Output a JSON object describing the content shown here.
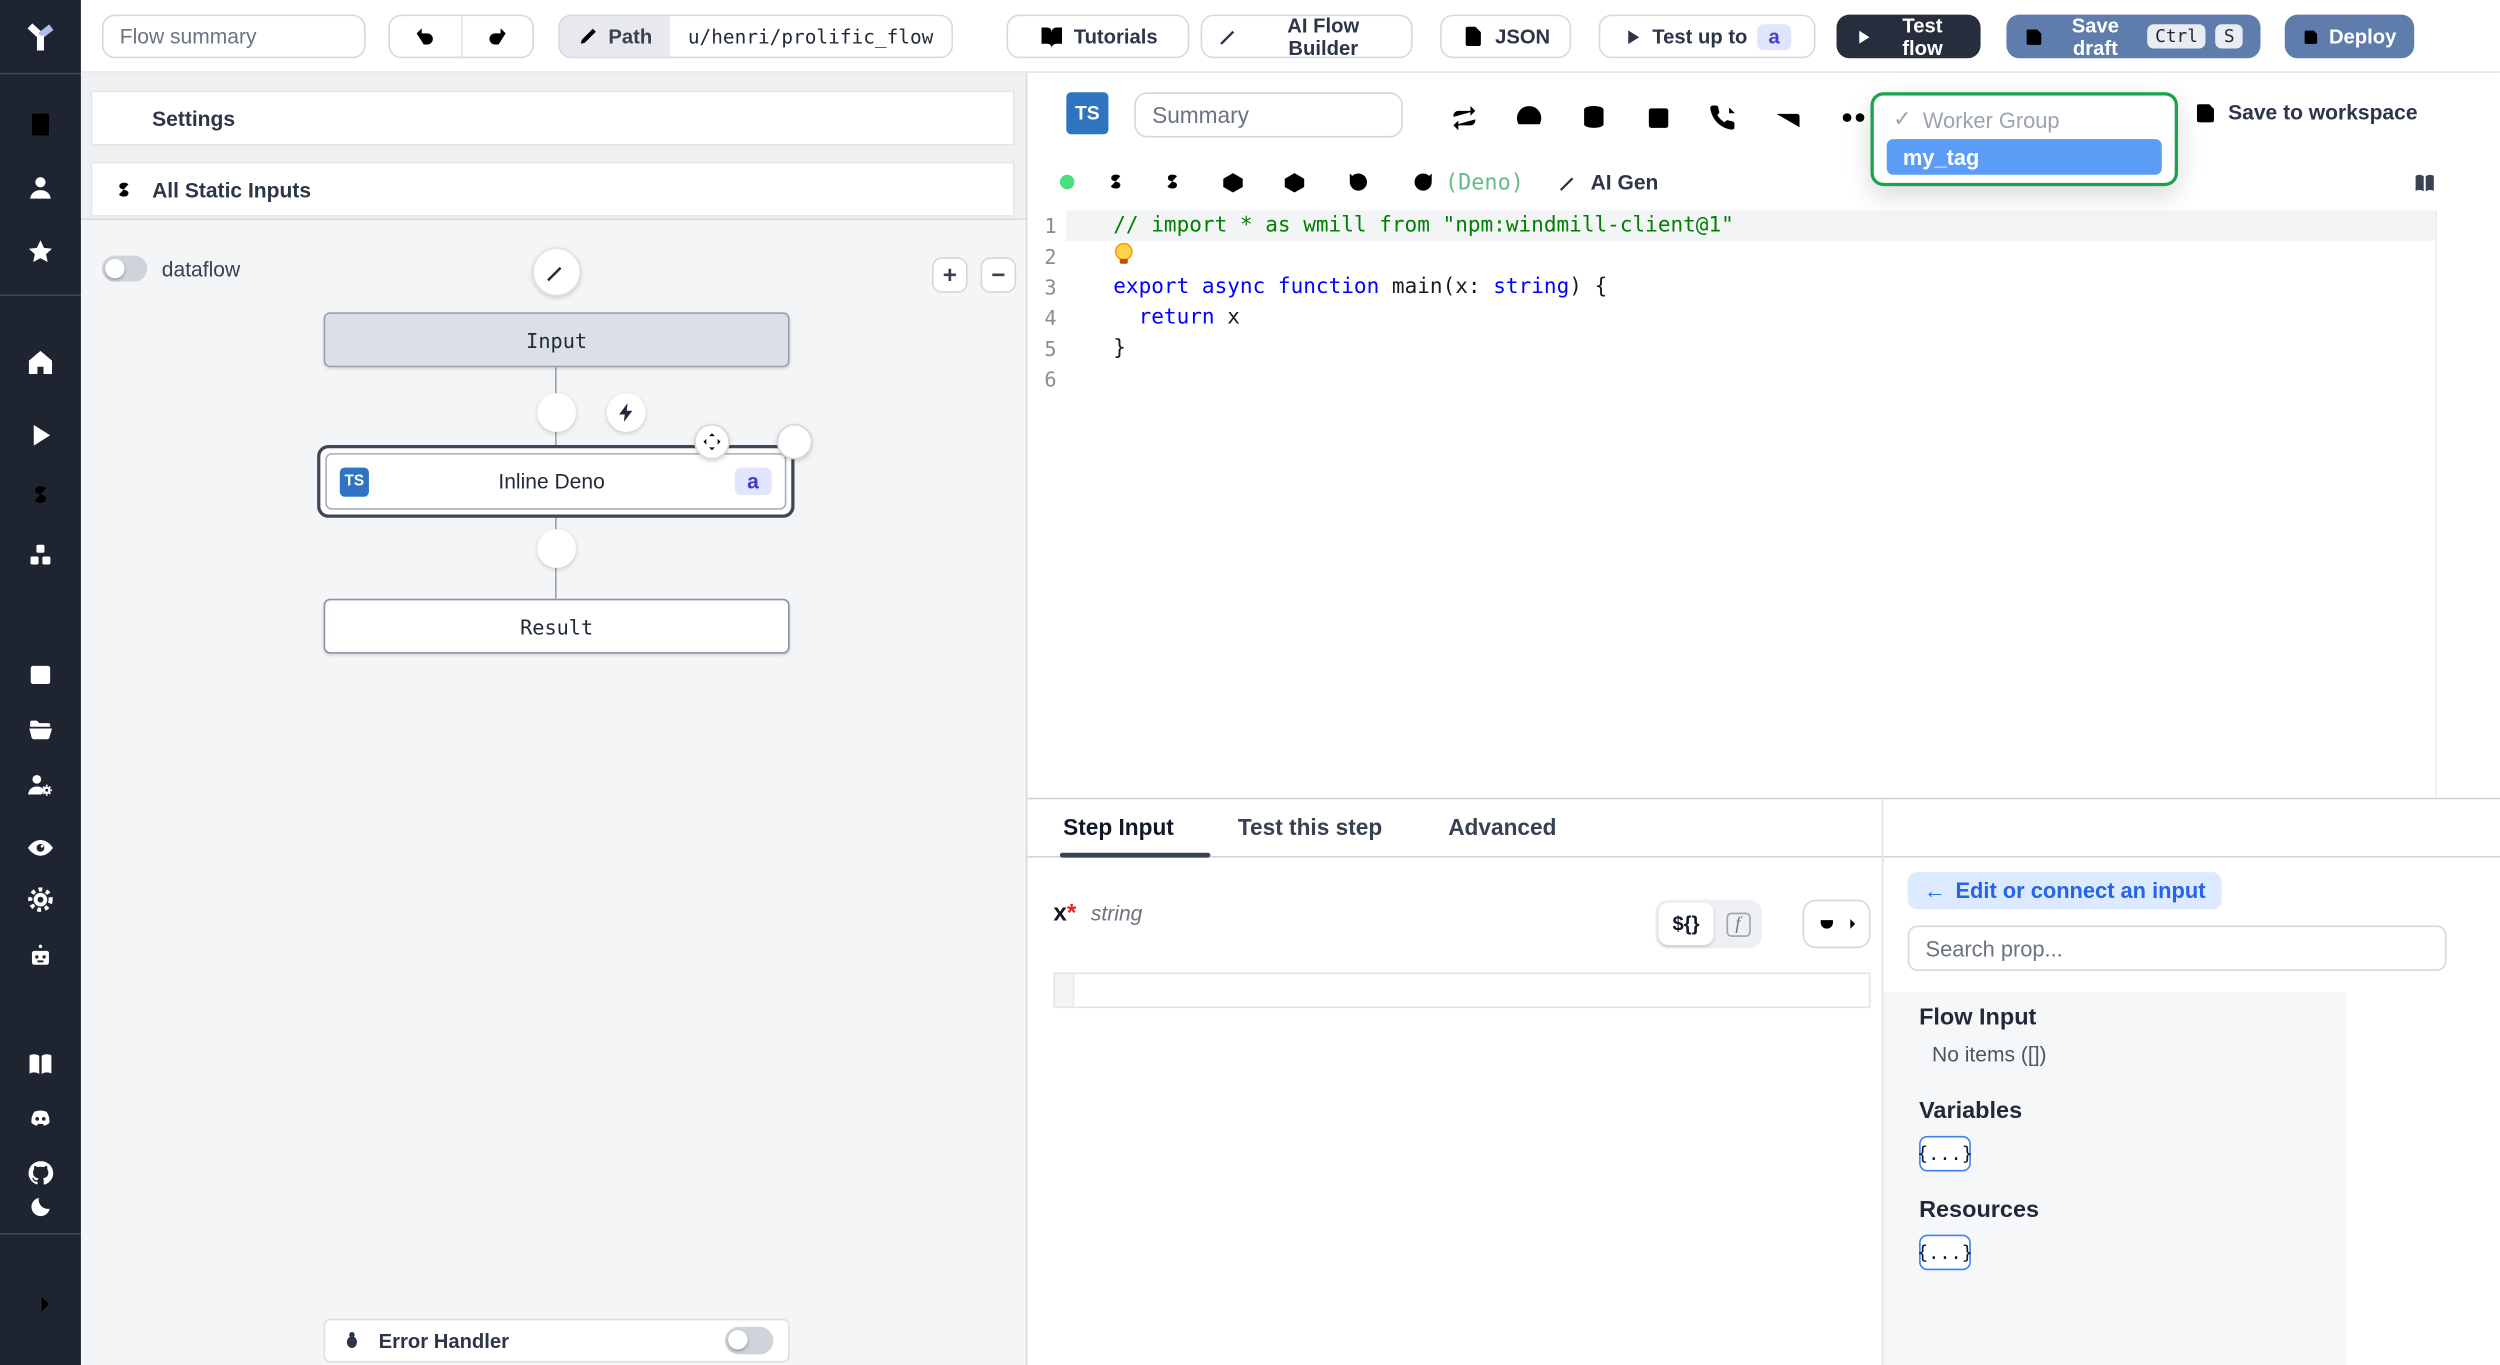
{
  "topbar": {
    "flow_summary_placeholder": "Flow summary",
    "path_button_label": "Path",
    "path_value": "u/henri/prolific_flow",
    "tutorials_label": "Tutorials",
    "ai_flow_builder_label": "AI Flow Builder",
    "json_label": "JSON",
    "test_up_to_label": "Test up to",
    "test_up_to_badge": "a",
    "test_flow_label": "Test flow",
    "save_draft_label": "Save draft",
    "shortcut_keys": [
      "Ctrl",
      "S"
    ],
    "deploy_label": "Deploy"
  },
  "sidebar": {
    "icons": [
      "windmill-logo",
      "building",
      "user",
      "star",
      "home",
      "play",
      "dollar",
      "boxes",
      "calendar",
      "folder-open",
      "users-cog",
      "eye",
      "gear",
      "bot",
      "book-open",
      "discord",
      "github",
      "moon",
      "arrow-right"
    ]
  },
  "flow_panel": {
    "settings_label": "Settings",
    "static_inputs_label": "All Static Inputs",
    "dataflow_label": "dataflow",
    "zoom_in": "+",
    "zoom_out": "−",
    "nodes": {
      "input_label": "Input",
      "step": {
        "language": "TS",
        "label": "Inline Deno",
        "badge": "a"
      },
      "result_label": "Result"
    },
    "error_handler_label": "Error Handler"
  },
  "editor": {
    "language_badge": "TS",
    "summary_placeholder": "Summary",
    "runtime_label": "(Deno)",
    "ai_gen_label": "AI Gen",
    "save_to_workspace_label": "Save to workspace",
    "worker_group_dropdown": {
      "check": "✓",
      "group_label": "Worker Group",
      "options": [
        {
          "label": "my_tag",
          "selected": true
        }
      ]
    },
    "toolbar_icons_row1": [
      "repeat",
      "gauge",
      "database",
      "square",
      "phone-incoming",
      "bed",
      "voicemail"
    ],
    "toolbar_icons_row2": [
      "status-dot",
      "dollar",
      "dollar",
      "package",
      "package",
      "rotate-ccw",
      "refresh-cw"
    ],
    "code": {
      "lines": [
        [
          {
            "t": "// import * as wmill from \"npm:windmill-client@1\"",
            "c": "comment"
          }
        ],
        [
          {
            "t": "lightbulb",
            "c": "bulb"
          }
        ],
        [
          {
            "t": "export",
            "c": "kw"
          },
          {
            "t": " ",
            "c": "pl"
          },
          {
            "t": "async",
            "c": "kw"
          },
          {
            "t": " ",
            "c": "pl"
          },
          {
            "t": "function",
            "c": "kw"
          },
          {
            "t": " main(x: ",
            "c": "pl"
          },
          {
            "t": "string",
            "c": "kw"
          },
          {
            "t": ") {",
            "c": "pl"
          }
        ],
        [
          {
            "t": "  ",
            "c": "pl"
          },
          {
            "t": "return",
            "c": "kw"
          },
          {
            "t": " x",
            "c": "pl"
          }
        ],
        [
          {
            "t": "}",
            "c": "pl"
          }
        ],
        []
      ]
    }
  },
  "step_panel": {
    "tabs": [
      {
        "label": "Step Input",
        "active": true
      },
      {
        "label": "Test this step",
        "active": false
      },
      {
        "label": "Advanced",
        "active": false
      }
    ],
    "field": {
      "name": "x",
      "required_marker": "*",
      "type": "string",
      "value": ""
    },
    "expr_toggle": {
      "template_label": "${}",
      "code_label": "f"
    },
    "props": {
      "back_arrow": "←",
      "edit_connect_label": "Edit or connect an input",
      "search_placeholder": "Search prop...",
      "flow_input_title": "Flow Input",
      "flow_input_empty": "No items ([])",
      "variables_title": "Variables",
      "variables_chip": "{...}",
      "resources_title": "Resources",
      "resources_chip": "{...}"
    }
  },
  "colors": {
    "sidebar_bg": "#1e2430",
    "primary_button_blue": "#5e7dac",
    "dark_button": "#262e3d",
    "selected_option_blue": "#5b9cf6",
    "dropdown_green_border": "#16a34a",
    "typescript_blue": "#2f74c0",
    "status_green": "#4ade80"
  }
}
